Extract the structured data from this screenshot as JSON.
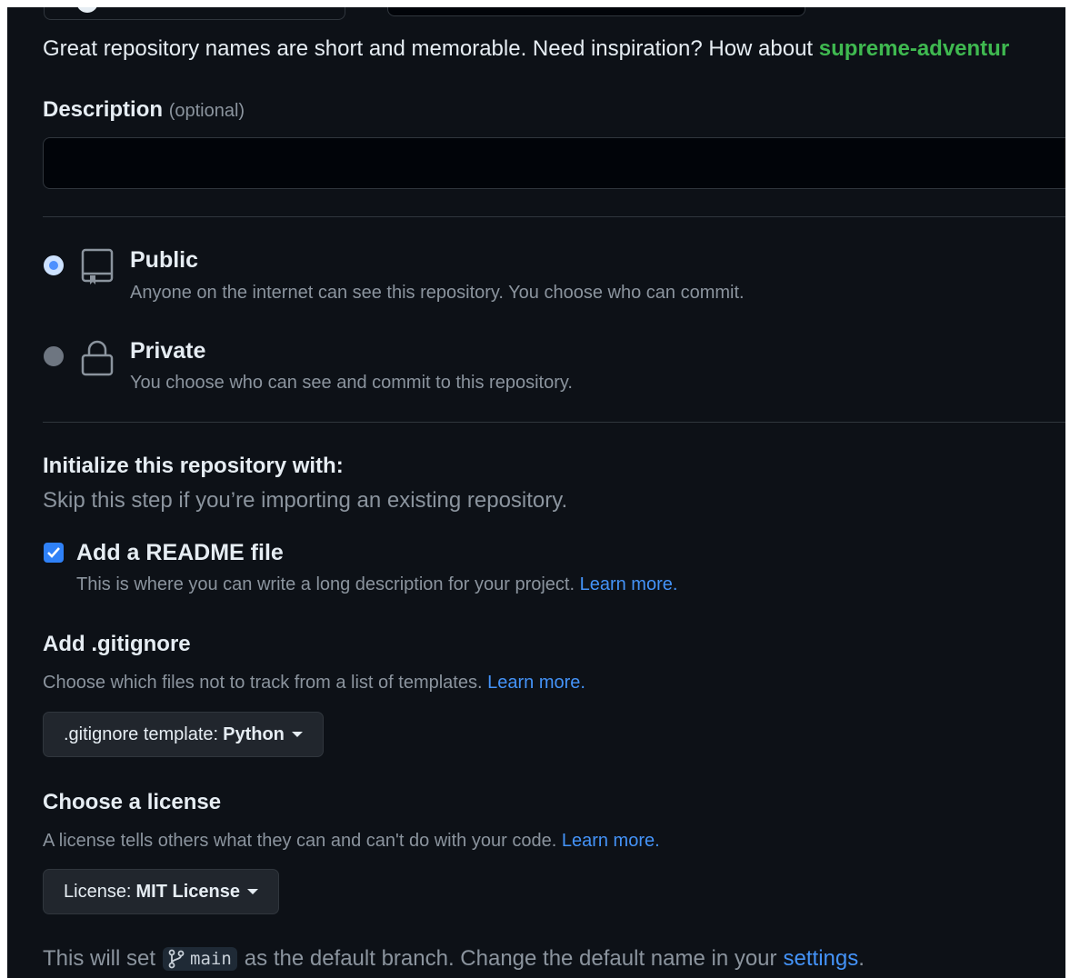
{
  "name_hint": {
    "text": "Great repository names are short and memorable. Need inspiration? How about ",
    "suggestion": "supreme-adventur"
  },
  "description": {
    "label": "Description",
    "optional": "(optional)",
    "value": ""
  },
  "visibility": {
    "public": {
      "title": "Public",
      "desc": "Anyone on the internet can see this repository. You choose who can commit.",
      "icon": "repo-icon",
      "selected": true
    },
    "private": {
      "title": "Private",
      "desc": "You choose who can see and commit to this repository.",
      "icon": "lock-icon",
      "selected": false
    }
  },
  "init": {
    "title": "Initialize this repository with:",
    "subtitle": "Skip this step if you’re importing an existing repository.",
    "readme": {
      "label": "Add a README file",
      "desc": "This is where you can write a long description for your project.",
      "link": "Learn more.",
      "checked": true
    }
  },
  "gitignore": {
    "title": "Add .gitignore",
    "desc": "Choose which files not to track from a list of templates.",
    "link": "Learn more.",
    "button_prefix": ".gitignore template:",
    "button_value": "Python"
  },
  "license": {
    "title": "Choose a license",
    "desc": "A license tells others what they can and can't do with your code.",
    "link": "Learn more.",
    "button_prefix": "License:",
    "button_value": "MIT License"
  },
  "footer": {
    "prefix": "This will set",
    "branch": "main",
    "middle": "as the default branch. Change the default name in your",
    "link": "settings",
    "suffix": "."
  },
  "colors": {
    "background": "#0d1117",
    "suggestion": "#3fb950",
    "link": "#4493f8",
    "checkbox": "#2f81f7"
  }
}
